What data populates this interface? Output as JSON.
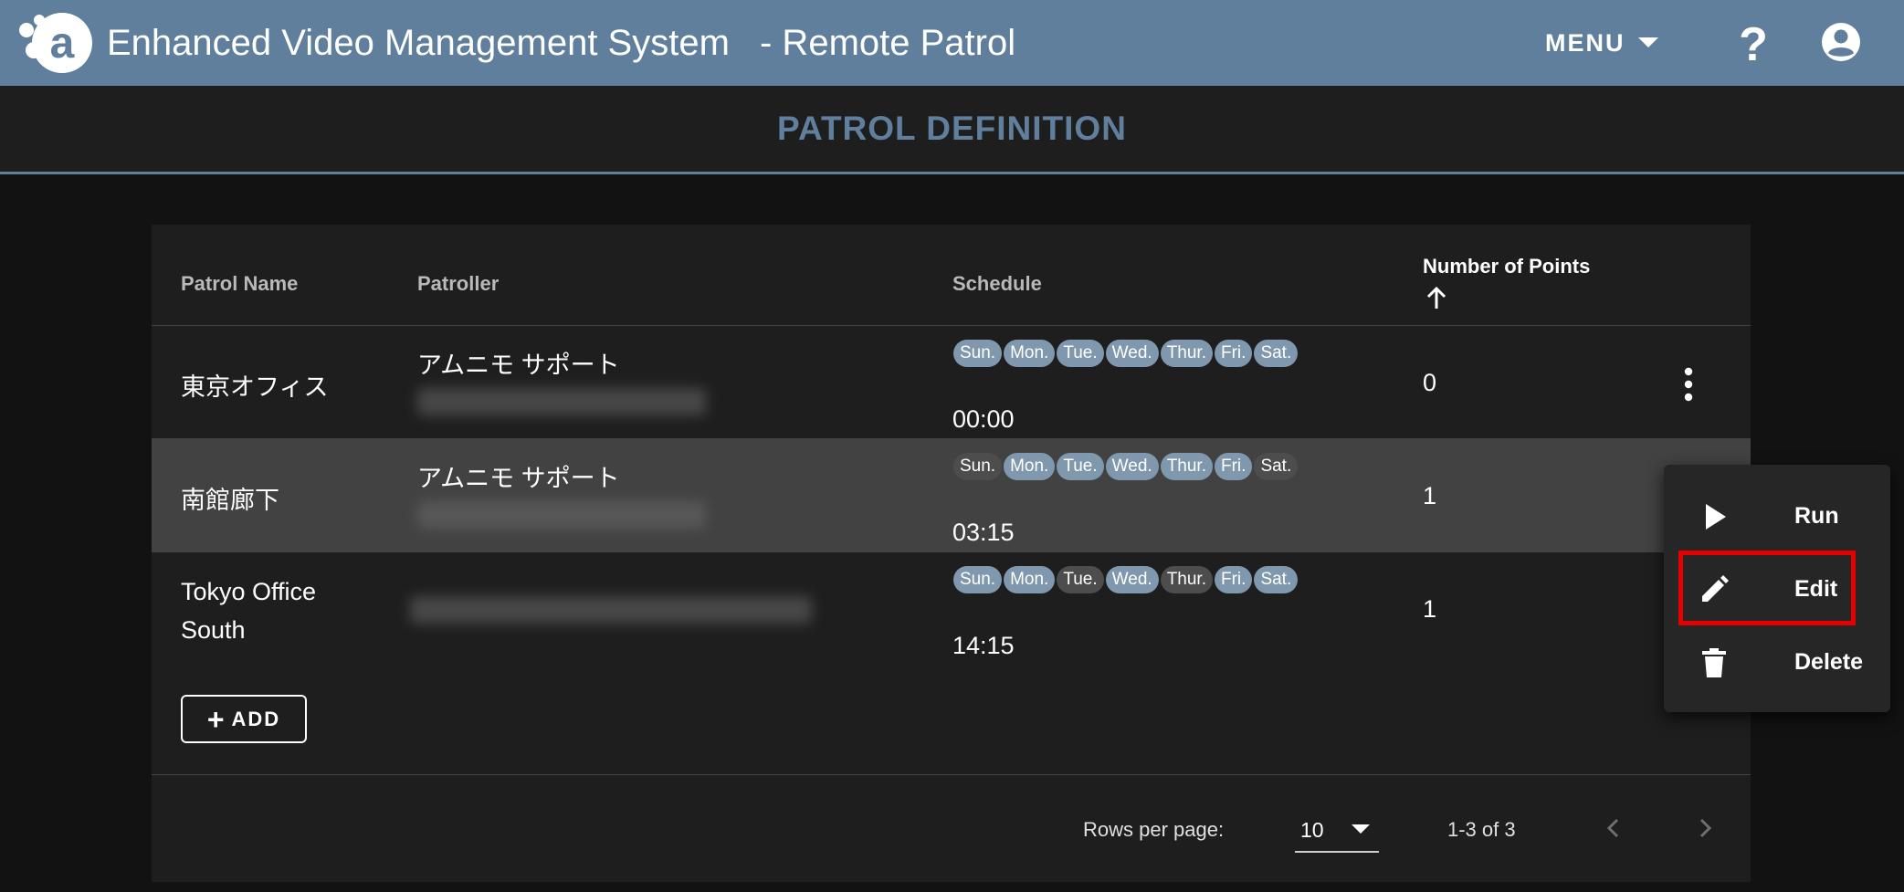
{
  "header": {
    "title": "Enhanced Video Management System",
    "subtitle": "- Remote Patrol",
    "menu_label": "MENU",
    "brand_color": "#5f7f9c"
  },
  "page": {
    "heading": "PATROL DEFINITION"
  },
  "table": {
    "columns": {
      "name": "Patrol Name",
      "patroller": "Patroller",
      "schedule": "Schedule",
      "points": "Number of Points"
    },
    "sort": {
      "column": "points",
      "direction": "ascending",
      "icon": "arrow-up-icon"
    },
    "days": [
      "Sun.",
      "Mon.",
      "Tue.",
      "Wed.",
      "Thur.",
      "Fri.",
      "Sat."
    ],
    "rows": [
      {
        "name": "東京オフィス",
        "patroller": "アムニモ サポート",
        "active_days": [
          true,
          true,
          true,
          true,
          true,
          true,
          true
        ],
        "time": "00:00",
        "points": "0"
      },
      {
        "name": "南館廊下",
        "patroller": "アムニモ サポート",
        "active_days": [
          false,
          true,
          true,
          true,
          true,
          true,
          false
        ],
        "time": "03:15",
        "points": "1"
      },
      {
        "name_line1": "Tokyo Office",
        "name_line2": "South",
        "patroller": "",
        "active_days": [
          true,
          true,
          false,
          true,
          false,
          true,
          true
        ],
        "time": "14:15",
        "points": "1"
      }
    ],
    "add_label": "ADD"
  },
  "pagination": {
    "rows_per_page_label": "Rows per page:",
    "rows_per_page_value": "10",
    "range_text": "1-3 of 3"
  },
  "context_menu": {
    "items": [
      {
        "label": "Run",
        "icon": "play-icon"
      },
      {
        "label": "Edit",
        "icon": "pencil-icon"
      },
      {
        "label": "Delete",
        "icon": "trash-icon"
      }
    ],
    "highlighted": "Edit",
    "highlight_color": "#e60000"
  }
}
